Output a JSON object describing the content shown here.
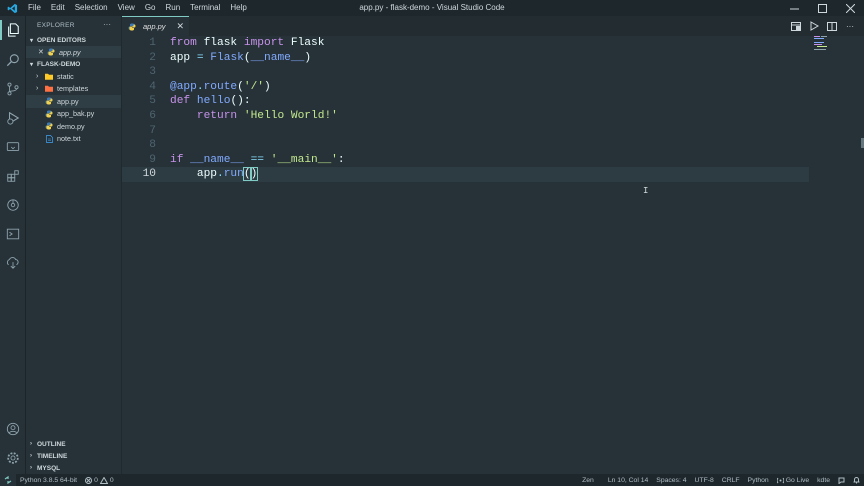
{
  "titlebar": {
    "menu": [
      "File",
      "Edit",
      "Selection",
      "View",
      "Go",
      "Run",
      "Terminal",
      "Help"
    ],
    "title": "app.py - flask-demo - Visual Studio Code"
  },
  "activitybar": {
    "icons": [
      "explorer-icon",
      "search-icon",
      "source-control-icon",
      "run-debug-icon",
      "remote-explorer-icon",
      "extensions-icon",
      "git-lens-icon",
      "terminal-icon",
      "live-share-icon",
      "account-icon",
      "settings-icon"
    ]
  },
  "sidebar": {
    "header": "EXPLORER",
    "more": "···",
    "open_editors": {
      "title": "OPEN EDITORS",
      "items": [
        {
          "close": "✕",
          "name": "app.py"
        }
      ]
    },
    "folder": {
      "title": "FLASK-DEMO",
      "items": [
        {
          "name": "static",
          "type": "folder"
        },
        {
          "name": "templates",
          "type": "folder"
        },
        {
          "name": "app.py",
          "type": "python"
        },
        {
          "name": "app_bak.py",
          "type": "python"
        },
        {
          "name": "demo.py",
          "type": "python"
        },
        {
          "name": "note.txt",
          "type": "text"
        }
      ]
    },
    "bottom": [
      "OUTLINE",
      "TIMELINE",
      "MYSQL"
    ]
  },
  "tabs": [
    {
      "label": "app.py",
      "close": "✕"
    }
  ],
  "editor": {
    "line_numbers": [
      "1",
      "2",
      "3",
      "4",
      "5",
      "6",
      "7",
      "8",
      "9",
      "10"
    ],
    "current_line": 10
  },
  "statusbar": {
    "python": "Python 3.8.5 64-bit",
    "errors": "0",
    "warnings": "0",
    "zen": "Zen",
    "position": "Ln 10, Col 14",
    "spaces": "Spaces: 4",
    "encoding": "UTF-8",
    "eol": "CRLF",
    "language": "Python",
    "golive": "Go Live",
    "user": "kdte"
  },
  "colors": {
    "accent": "#80cbc4",
    "background": "#263238",
    "keyword": "#c792ea",
    "function": "#82aaff",
    "string": "#c3e88d"
  }
}
